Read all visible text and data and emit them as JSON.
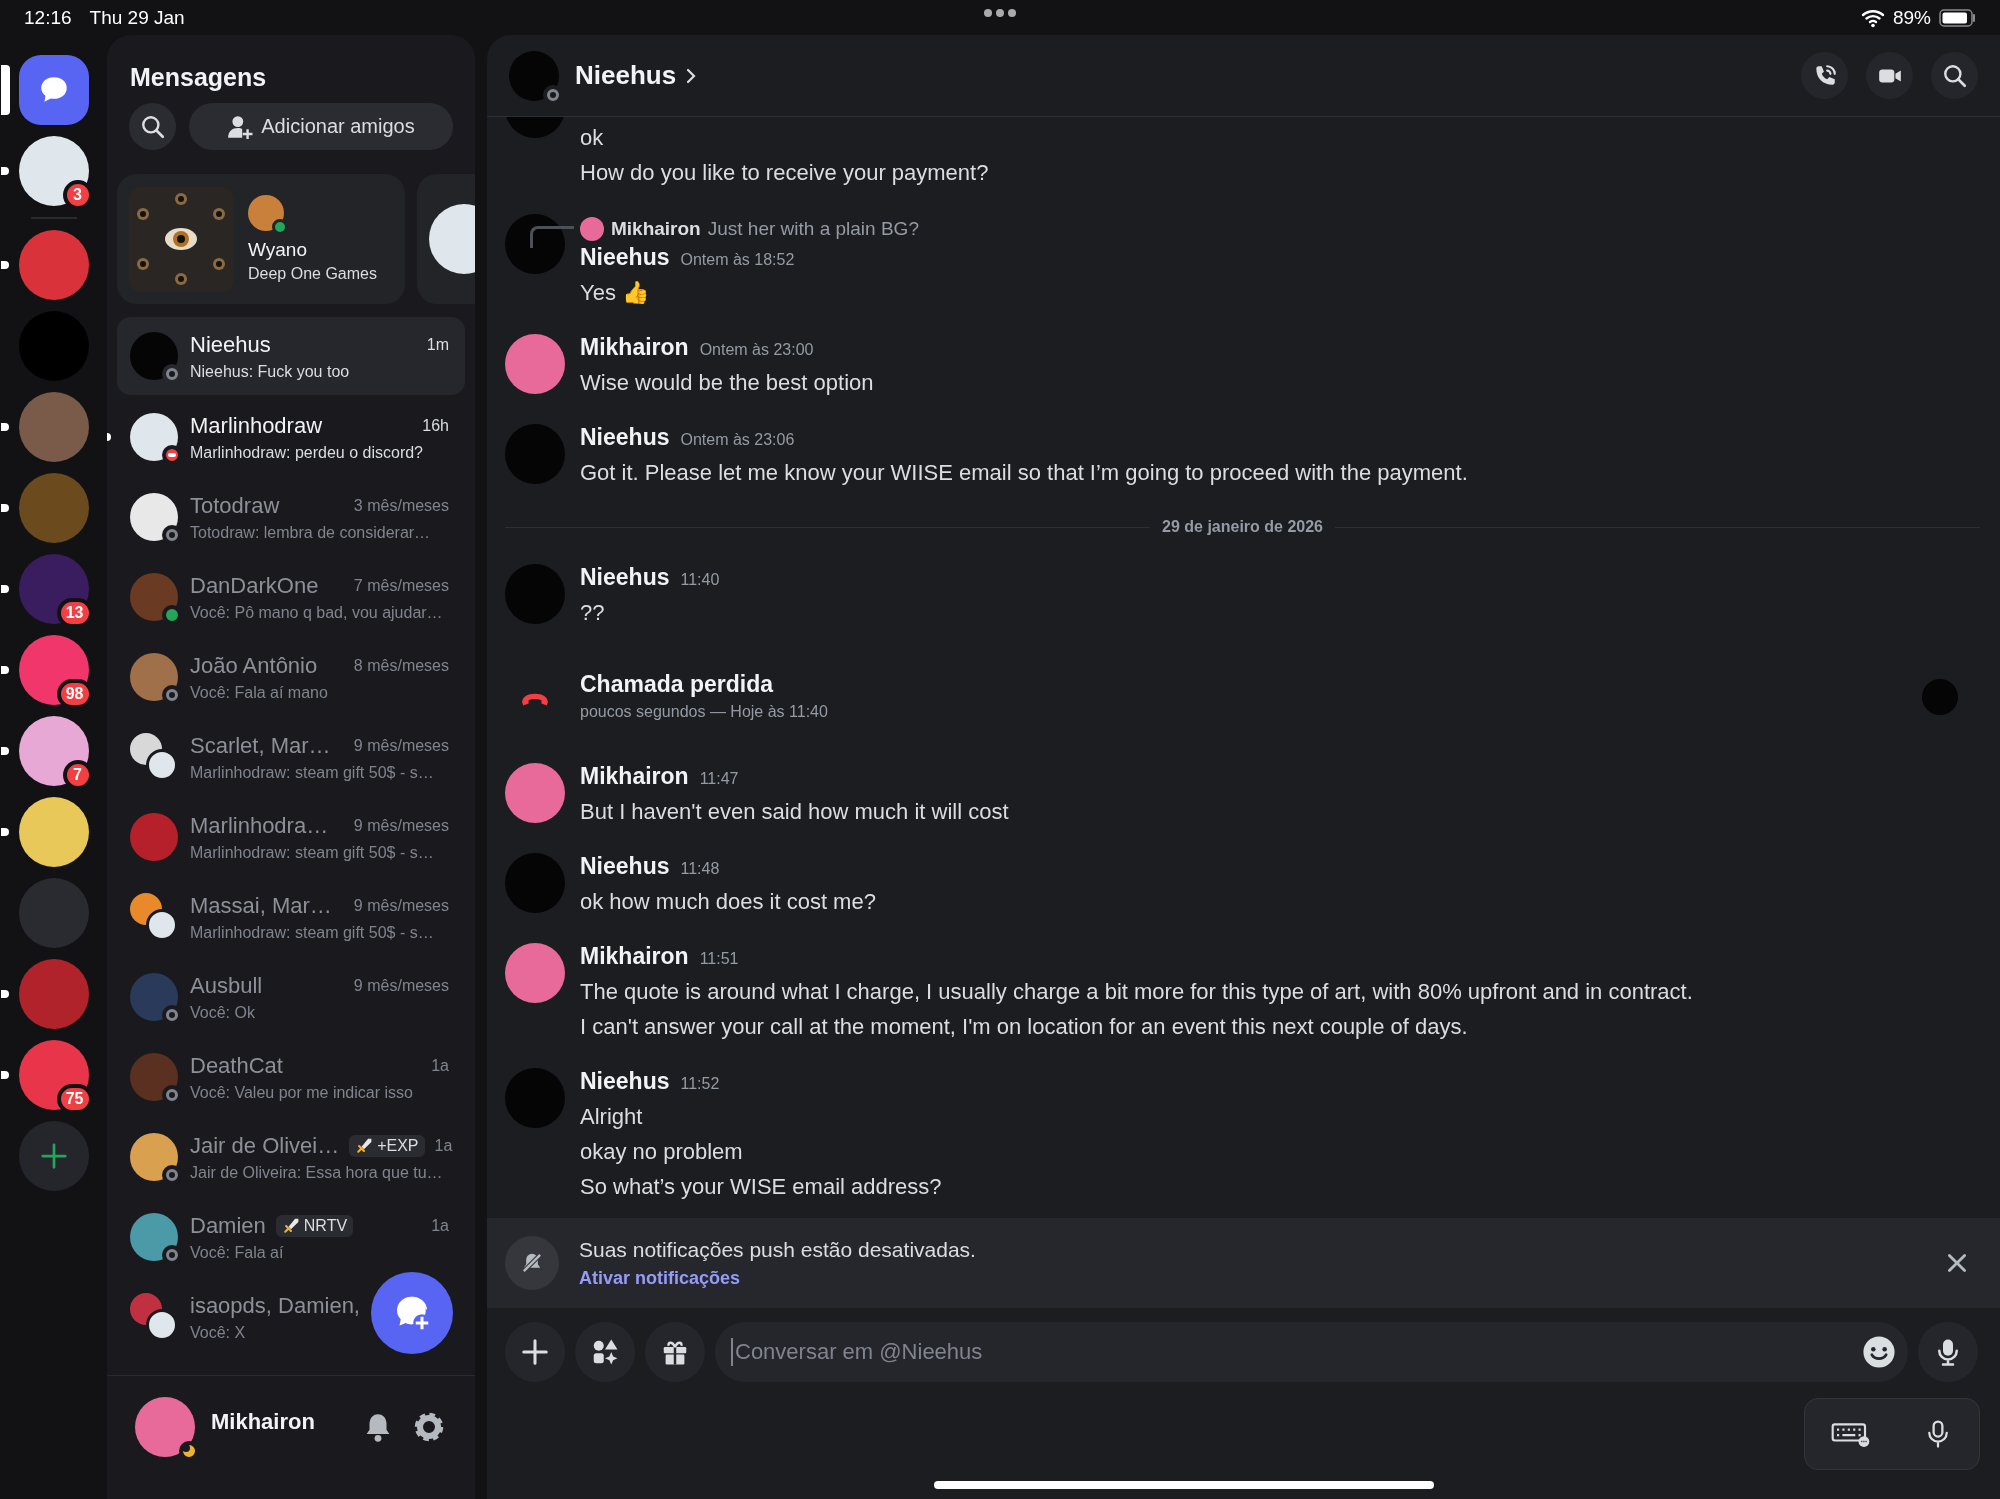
{
  "status_bar": {
    "time": "12:16",
    "date": "Thu 29 Jan",
    "battery": "89%"
  },
  "servers": [
    {
      "kind": "dm",
      "selected": true,
      "color": "#5865f2"
    },
    {
      "kind": "dm_avatar",
      "selected": false,
      "unread": true,
      "color": "#dfe6ec",
      "badge": "3"
    },
    {
      "kind": "avatar",
      "selected": false,
      "unread": true,
      "color": "#d9323a"
    },
    {
      "kind": "avatar",
      "selected": false,
      "unread": false,
      "color": "#000000"
    },
    {
      "kind": "avatar",
      "selected": false,
      "unread": true,
      "color": "#7a5a48"
    },
    {
      "kind": "avatar",
      "selected": false,
      "unread": true,
      "color": "#6b4a1e"
    },
    {
      "kind": "avatar",
      "selected": false,
      "unread": true,
      "color": "#3a1d5e",
      "badge": "13"
    },
    {
      "kind": "avatar",
      "selected": false,
      "unread": true,
      "color": "#f0366a",
      "badge": "98"
    },
    {
      "kind": "avatar",
      "selected": false,
      "unread": true,
      "color": "#e8a8d6",
      "badge": "7"
    },
    {
      "kind": "avatar",
      "selected": false,
      "unread": true,
      "color": "#e9c85a"
    },
    {
      "kind": "avatar",
      "selected": false,
      "unread": false,
      "color": "#2a2b30"
    },
    {
      "kind": "avatar",
      "selected": false,
      "unread": true,
      "color": "#b0232b"
    },
    {
      "kind": "avatar",
      "selected": false,
      "unread": true,
      "color": "#e8354a",
      "badge": "75"
    },
    {
      "kind": "add",
      "selected": false,
      "unread": false,
      "color": "#25262b"
    }
  ],
  "dm_panel": {
    "title": "Mensagens",
    "add_friends": "Adicionar amigos",
    "featured": [
      {
        "kind": "activity",
        "name": "Wyano",
        "activity": "Deep One Games",
        "presence": {
          "kind": "online",
          "color": "#23a55a"
        }
      },
      {
        "kind": "peek"
      }
    ],
    "conversations": [
      {
        "kind": "direct",
        "name": "Nieehus",
        "time": "1m",
        "preview": "Nieehus: Fuck you too",
        "presence": {
          "kind": "offline",
          "color": "#80848e"
        },
        "selected": true,
        "unread": false,
        "color": "#050505"
      },
      {
        "kind": "direct",
        "name": "Marlinhodraw",
        "time": "16h",
        "preview": "Marlinhodraw: perdeu o discord?",
        "presence": {
          "kind": "dnd",
          "color": "#f23f43"
        },
        "selected": false,
        "unread": true,
        "color": "#dfe6ec"
      },
      {
        "kind": "direct",
        "name": "Totodraw",
        "time": "3 mês/meses",
        "preview": "Totodraw: lembra de considerar…",
        "presence": {
          "kind": "offline",
          "color": "#80848e"
        },
        "selected": false,
        "unread": false,
        "color": "#e8e8e8"
      },
      {
        "kind": "direct",
        "name": "DanDarkOne",
        "time": "7 mês/meses",
        "preview": "Você: Pô mano q bad, vou ajudar…",
        "presence": {
          "kind": "online",
          "color": "#23a55a"
        },
        "selected": false,
        "unread": false,
        "color": "#6a3a22"
      },
      {
        "kind": "direct",
        "name": "João Antônio",
        "time": "8 mês/meses",
        "preview": "Você: Fala aí mano",
        "presence": {
          "kind": "offline",
          "color": "#80848e"
        },
        "selected": false,
        "unread": false,
        "color": "#a0704a"
      },
      {
        "kind": "group",
        "name": "Scarlet, Mar…",
        "time": "9 mês/meses",
        "preview": "Marlinhodraw: steam gift 50$ - s…",
        "selected": false,
        "unread": false,
        "color": "#d8d8d8"
      },
      {
        "kind": "direct",
        "name": "Marlinhodra…",
        "time": "9 mês/meses",
        "preview": "Marlinhodraw: steam gift 50$ - s…",
        "selected": false,
        "unread": false,
        "color": "#b5202a"
      },
      {
        "kind": "group",
        "name": "Massai, Mar…",
        "time": "9 mês/meses",
        "preview": "Marlinhodraw: steam gift 50$ - s…",
        "selected": false,
        "unread": false,
        "color": "#e88a2a"
      },
      {
        "kind": "direct",
        "name": "Ausbull",
        "time": "9 mês/meses",
        "preview": "Você: Ok",
        "presence": {
          "kind": "offline",
          "color": "#80848e"
        },
        "selected": false,
        "unread": false,
        "color": "#2a3a5a"
      },
      {
        "kind": "direct",
        "name": "DeathCat",
        "time": "1a",
        "preview": "Você: Valeu por me indicar isso",
        "presence": {
          "kind": "offline",
          "color": "#80848e"
        },
        "selected": false,
        "unread": false,
        "color": "#5a3020"
      },
      {
        "kind": "direct",
        "name": "Jair de Olivei…",
        "tag": "+EXP",
        "time": "1a",
        "preview": "Jair de Oliveira: Essa hora que tu…",
        "presence": {
          "kind": "offline",
          "color": "#80848e"
        },
        "selected": false,
        "unread": false,
        "color": "#d9a050"
      },
      {
        "kind": "direct",
        "name": "Damien",
        "tag": "NRTV",
        "time": "1a",
        "preview": "Você: Fala aí",
        "presence": {
          "kind": "offline",
          "color": "#80848e"
        },
        "selected": false,
        "unread": false,
        "color": "#4a9aa8"
      },
      {
        "kind": "group",
        "name": "isaopds, Damien,",
        "preview": "Você: X",
        "selected": false,
        "unread": false,
        "color": "#c03040"
      }
    ],
    "user": {
      "name": "Mikhairon",
      "presence": {
        "kind": "idle",
        "color": "#f0b232"
      },
      "color": "#e86a9a"
    }
  },
  "chat": {
    "title": "Nieehus",
    "presence": {
      "kind": "offline",
      "color": "#80848e"
    },
    "messages": [
      {
        "kind": "continued",
        "color": "#050505",
        "lines": [
          "ok",
          "How do you like to receive your payment?"
        ]
      },
      {
        "kind": "group",
        "author": "Nieehus",
        "time": "Ontem às 18:52",
        "color": "#050505",
        "reply": {
          "author": "Mikhairon",
          "text": "Just her with a plain BG?",
          "color": "#e86a9a"
        },
        "lines": [
          "Yes 👍"
        ]
      },
      {
        "kind": "group",
        "author": "Mikhairon",
        "time": "Ontem às 23:00",
        "color": "#e86a9a",
        "lines": [
          "Wise would be the best option"
        ]
      },
      {
        "kind": "group",
        "author": "Nieehus",
        "time": "Ontem às 23:06",
        "color": "#050505",
        "lines": [
          "Got it. Please let me know your WIISE email so that I’m going to proceed with the payment."
        ]
      },
      {
        "kind": "divider",
        "text": "29 de janeiro de 2026"
      },
      {
        "kind": "group",
        "author": "Nieehus",
        "time": "11:40",
        "color": "#050505",
        "lines": [
          "??"
        ]
      },
      {
        "kind": "call",
        "title": "Chamada perdida",
        "detail": "poucos segundos — Hoje às 11:40",
        "color": "#050505"
      },
      {
        "kind": "group",
        "author": "Mikhairon",
        "time": "11:47",
        "color": "#e86a9a",
        "lines": [
          "But I haven't even said how much it will cost"
        ]
      },
      {
        "kind": "group",
        "author": "Nieehus",
        "time": "11:48",
        "color": "#050505",
        "lines": [
          "ok how much does it cost me?"
        ]
      },
      {
        "kind": "group",
        "author": "Mikhairon",
        "time": "11:51",
        "color": "#e86a9a",
        "lines": [
          "The quote is around what I charge, I usually charge a bit more for this type of art, with 80% upfront and in contract.",
          "I can't answer your call at the moment, I'm on location for an event this next couple of days."
        ]
      },
      {
        "kind": "group",
        "author": "Nieehus",
        "time": "11:52",
        "color": "#050505",
        "lines": [
          "Alright",
          "okay no problem",
          "So what’s your WISE email address?"
        ]
      }
    ],
    "notice": {
      "text": "Suas notificações push estão desativadas.",
      "link": "Ativar notificações"
    },
    "input": {
      "placeholder": "Conversar em @Nieehus"
    }
  }
}
